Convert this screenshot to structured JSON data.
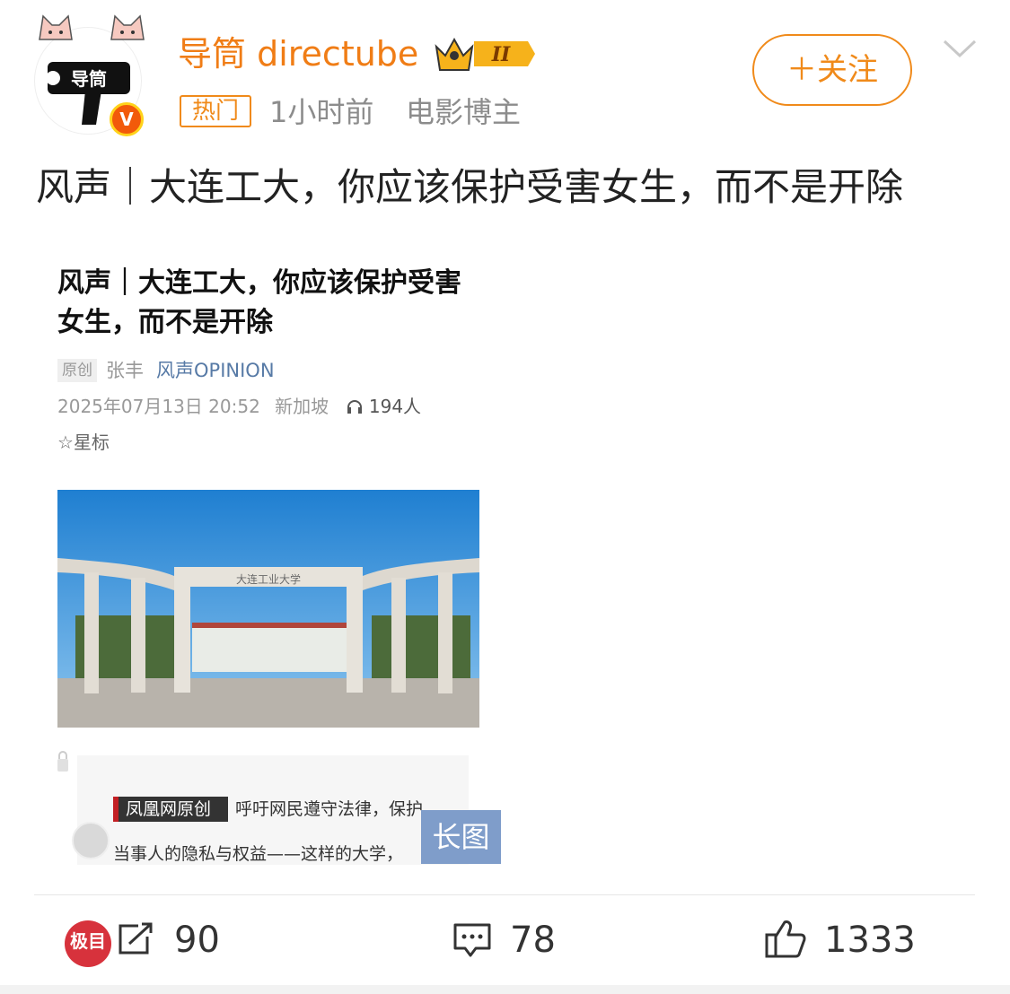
{
  "user": {
    "name": "导筒 directube",
    "vip_level": "II",
    "avatar_text": "导筒",
    "verified_mark": "V"
  },
  "meta": {
    "hot_tag": "热门",
    "time": "1小时前",
    "tag": "电影博主"
  },
  "follow_label": "＋关注",
  "post_text": "风声｜大连工大，你应该保护受害女生，而不是开除",
  "article": {
    "title": "风声｜大连工大，你应该保护受害女生，而不是开除",
    "original_badge": "原创",
    "author": "张丰",
    "source": "风声OPINION",
    "date": "2025年07月13日 20:52",
    "location": "新加坡",
    "listeners": "194人",
    "star_label": "星标",
    "campus_sign": "大连工业大学",
    "ifeng_badge": "凤凰网原创",
    "caption_line1": "呼吁网民遵守法律，保护",
    "caption_line2": "当事人的隐私与权益——这样的大学，",
    "long_image_label": "长图"
  },
  "actions": {
    "jimu_label": "极目",
    "share_count": "90",
    "comment_count": "78",
    "like_count": "1333"
  },
  "colors": {
    "brand_orange": "#f07d16",
    "meta_gray": "#8c8c8c",
    "long_badge": "#7f9dca"
  }
}
